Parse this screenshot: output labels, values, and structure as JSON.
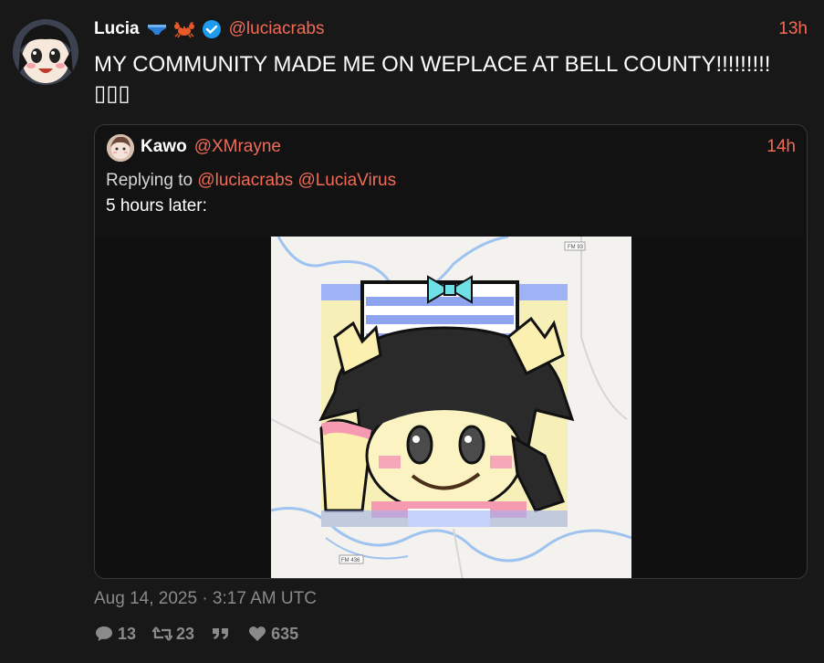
{
  "tweet": {
    "display_name": "Lucia",
    "handle": "@luciacrabs",
    "time": "13h",
    "text": "MY COMMUNITY MADE ME ON WEPLACE AT BELL COUNTY!!!!!!!!! ▯▯▯",
    "badges": [
      "underwear-emoji-icon",
      "crab-emoji-icon",
      "verified-check-icon"
    ]
  },
  "quote": {
    "display_name": "Kawo",
    "handle": "@XMrayne",
    "time": "14h",
    "replying_prefix": "Replying to",
    "mentions": [
      "@luciacrabs",
      "@LuciaVirus"
    ],
    "text": "5 hours later:",
    "map_labels": [
      "FM 93",
      "FM 436"
    ]
  },
  "footer": {
    "date": "Aug 14, 2025 · 3:17 AM UTC",
    "replies": "13",
    "retweets": "23",
    "quotes_icon": "quote-icon",
    "likes": "635"
  },
  "colors": {
    "background": "#181818",
    "accent": "#f26b57",
    "muted": "#8a8a8a",
    "verified": "#1d9bf0"
  }
}
